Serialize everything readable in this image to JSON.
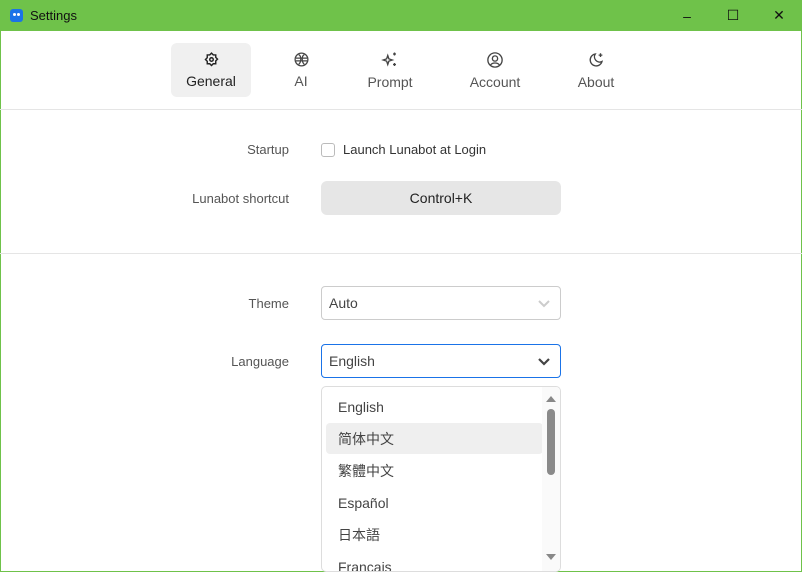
{
  "window": {
    "title": "Settings",
    "minimize": "–",
    "maximize": "☐",
    "close": "✕"
  },
  "tabs": [
    {
      "label": "General",
      "icon": "gear-icon"
    },
    {
      "label": "AI",
      "icon": "ai-knot-icon"
    },
    {
      "label": "Prompt",
      "icon": "sparkles-icon"
    },
    {
      "label": "Account",
      "icon": "user-circle-icon"
    },
    {
      "label": "About",
      "icon": "moon-star-icon"
    }
  ],
  "general": {
    "startup_label": "Startup",
    "launch_at_login": "Launch Lunabot at Login",
    "launch_checked": false,
    "shortcut_label": "Lunabot shortcut",
    "shortcut_value": "Control+K",
    "theme_label": "Theme",
    "theme_value": "Auto",
    "language_label": "Language",
    "language_value": "English",
    "language_options": [
      "English",
      "简体中文",
      "繁體中文",
      "Español",
      "日本語",
      "Français"
    ],
    "highlighted_option": "简体中文"
  },
  "colors": {
    "titlebar": "#6fc24a",
    "focus": "#1a73e8"
  }
}
